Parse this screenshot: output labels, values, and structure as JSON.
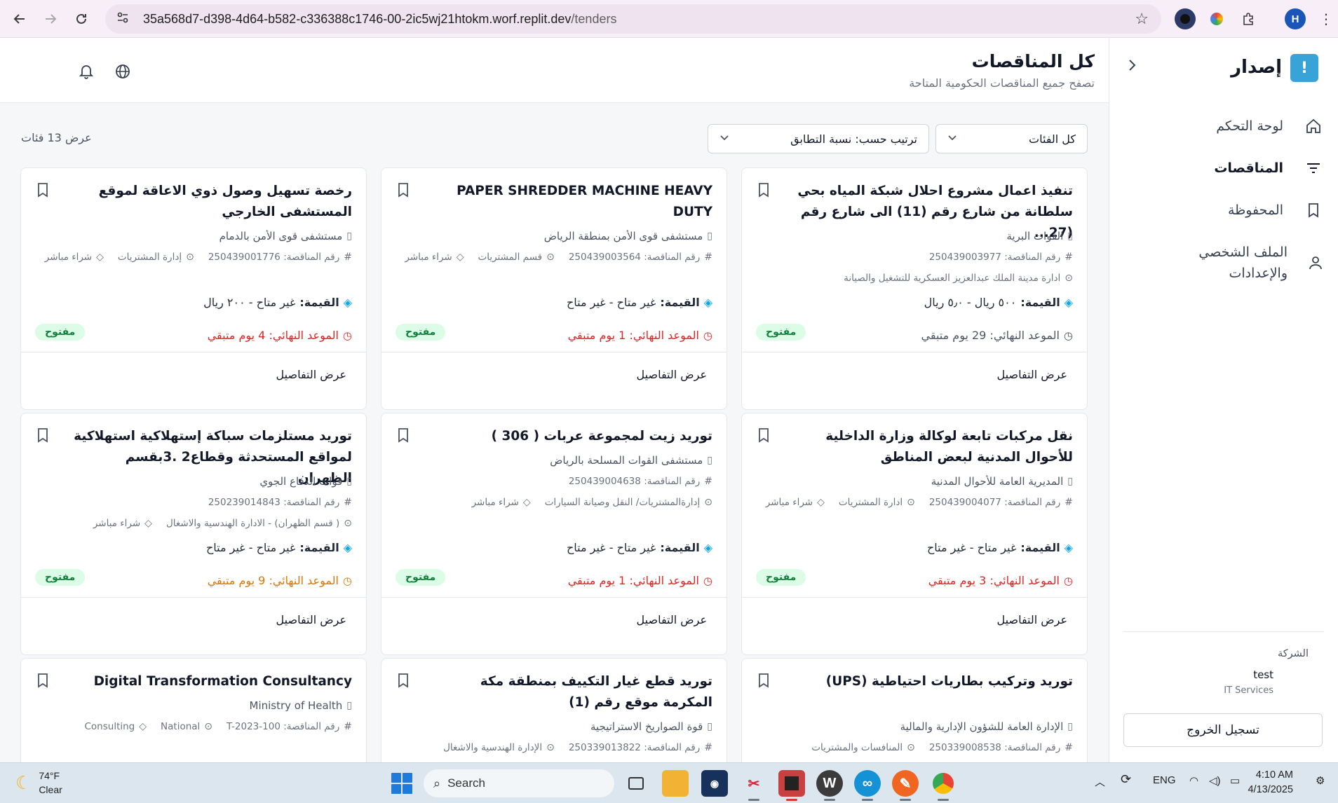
{
  "browser": {
    "url_host": "35a568d7-d398-4d64-b582-c336388c1746-00-2ic5wj21htokm.worf.replit.dev",
    "url_path": "/tenders",
    "profile_initial": "H"
  },
  "header": {
    "title": "كل المناقصات",
    "subtitle": "تصفح جميع المناقصات الحكومية المتاحة"
  },
  "filters": {
    "category": "كل الفئات",
    "sort": "ترتيب حسب: نسبة التطابق",
    "count_text": "عرض 13 فئات"
  },
  "labels": {
    "tender_no": "رقم المناقصة:",
    "value": "القيمة:",
    "deadline": "الموعد النهائي:",
    "details": "عرض التفاصيل"
  },
  "tenders": [
    {
      "title": "تنفيذ اعمال مشروع احلال شبكة المياه بحي سلطانة من شارع رقم (11) الى شارع رقم (27...",
      "org": "القوات البرية",
      "number": "250439003977",
      "location": "ادارة مدينة الملك عبدالعزيز العسكرية للتشغيل والصيانة",
      "type": "",
      "value": "٥٠٠ ريال - ٥٫٠ ريال",
      "deadline": "29 يوم متبقي",
      "deadline_color": "gray",
      "status": "مفتوح"
    },
    {
      "title": "PAPER SHREDDER MACHINE HEAVY DUTY",
      "org": "مستشفى قوى الأمن بمنطقة الرياض",
      "number": "250439003564",
      "location": "قسم المشتريات",
      "type": "شراء مباشر",
      "value": "غير متاح - غير متاح",
      "deadline": "1 يوم متبقي",
      "deadline_color": "red",
      "status": "مفتوح"
    },
    {
      "title": "رخصة تسهيل وصول ذوي الاعاقة لموقع المستشفى الخارجي",
      "org": "مستشفى قوى الأمن بالدمام",
      "number": "250439001776",
      "location": "إدارة المشتريات",
      "type": "شراء مباشر",
      "value": "غير متاح - ٢٠٠ ريال",
      "deadline": "4 يوم متبقي",
      "deadline_color": "red",
      "status": "مفتوح"
    },
    {
      "title": "نقل مركبات تابعة لوكالة وزارة الداخلية للأحوال المدنية لبعض المناطق",
      "org": "المديرية العامة للأحوال المدنية",
      "number": "250439004077",
      "location": "ادارة المشتريات",
      "type": "شراء مباشر",
      "value": "غير متاح - غير متاح",
      "deadline": "3 يوم متبقي",
      "deadline_color": "red",
      "status": "مفتوح"
    },
    {
      "title": "توريد زيت لمجموعة عربات ( 306 )",
      "org": "مستشفى القوات المسلحة بالرياض",
      "number": "250439004638",
      "location": "إدارةالمشتريات/ النقل وصيانة السيارات",
      "type": "شراء مباشر",
      "value": "غير متاح - غير متاح",
      "deadline": "1 يوم متبقي",
      "deadline_color": "red",
      "status": "مفتوح"
    },
    {
      "title": "توريد مستلزمات سباكة إستهلاكية استهلاكية لمواقع المستحدثة وقطاع2 .3بقسم الظهران",
      "org": "قوات الدفاع الجوي",
      "number": "250239014843",
      "location": "( قسم الظهران) - الادارة الهندسية والاشغال",
      "type": "شراء مباشر",
      "value": "غير متاح - غير متاح",
      "deadline": "9 يوم متبقي",
      "deadline_color": "orange",
      "status": "مفتوح"
    },
    {
      "title": "توريد وتركيب بطاريات احتياطية (UPS)",
      "org": "الإدارة العامة للشؤون الإدارية والمالية",
      "number": "250339008538",
      "location": "المنافسات والمشتريات",
      "type": "",
      "value": "",
      "deadline": "",
      "deadline_color": "gray",
      "status": ""
    },
    {
      "title": "توريد قطع غيار التكييف بمنطقة مكة المكرمة موقع رقم (1)",
      "org": "قوة الصواريخ الاستراتيجية",
      "number": "250339013822",
      "location": "الإدارة الهندسية والاشغال",
      "type": "",
      "value": "",
      "deadline": "",
      "deadline_color": "gray",
      "status": ""
    },
    {
      "title": "Digital Transformation Consultancy",
      "org": "Ministry of Health",
      "number": "T-2023-100",
      "location": "National",
      "type": "Consulting",
      "value": "",
      "deadline": "",
      "deadline_color": "gray",
      "status": ""
    }
  ],
  "sidebar": {
    "logo_mark": "!",
    "brand": "إصدار",
    "items": [
      {
        "label": "لوحة التحكم",
        "icon": "home-icon"
      },
      {
        "label": "المناقصات",
        "icon": "filter-icon"
      },
      {
        "label": "المحفوظة",
        "icon": "bookmark-icon"
      },
      {
        "label": "الملف الشخصي والإعدادات",
        "icon": "user-icon"
      }
    ],
    "company_label": "الشركة",
    "company_name": "test",
    "company_type": "IT Services",
    "logout": "تسجيل الخروج"
  },
  "taskbar": {
    "temp": "74°F",
    "weather": "Clear",
    "search": "Search",
    "lang": "ENG",
    "time": "4:10 AM",
    "date": "4/13/2025"
  },
  "colors": {
    "accent": "#38a3d6",
    "deadline_red": "#dc2626",
    "deadline_orange": "#d97706",
    "badge_bg": "#dcfce7",
    "badge_text": "#15803d"
  }
}
